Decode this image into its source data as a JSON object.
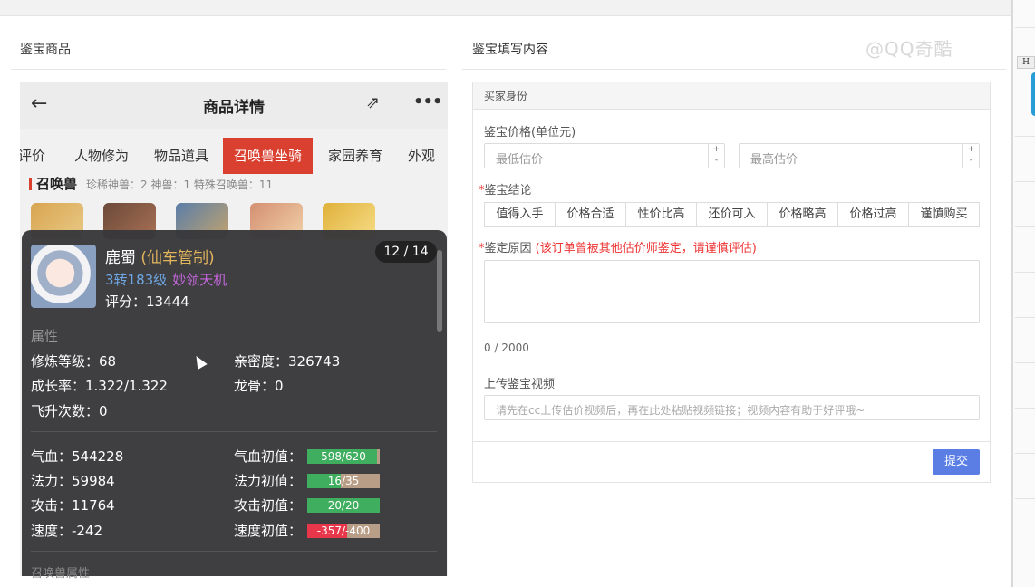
{
  "left_title": "鉴宝商品",
  "right_title": "鉴宝填写内容",
  "watermark": "@QQ奇酷",
  "sheet_col": "H",
  "phone": {
    "title": "商品详情",
    "back_icon": "←",
    "share_icon": "⇗",
    "more_icon": "•••",
    "tabs": [
      "评价",
      "人物修为",
      "物品道具",
      "召唤兽坐骑",
      "家园养育",
      "外观"
    ],
    "pet_label": "召唤兽",
    "pet_summary": "珍稀神兽：2   神兽：1   特殊召唤兽：11"
  },
  "card": {
    "name": "鹿蜀",
    "sub": "(仙车管制)",
    "counter": "12 / 14",
    "level": "3转183级",
    "magic": "妙领天机",
    "score": "评分：13444",
    "section": "属性",
    "stats_left": [
      "修炼等级：68",
      "成长率：1.322/1.322",
      "飞升次数：0"
    ],
    "stats_right": [
      "亲密度：326743",
      "龙骨：0"
    ],
    "attrs_left": [
      "气血：544228",
      "法力：59984",
      "攻击：11764",
      "速度：-242"
    ],
    "attrs_right": [
      "气血初值：",
      "法力初值：",
      "攻击初值：",
      "速度初值："
    ],
    "bars": [
      {
        "text": "598/620",
        "fraction": 0.96,
        "color": "#3fae5f"
      },
      {
        "text": "16/35",
        "fraction": 0.46,
        "color": "#3fae5f"
      },
      {
        "text": "20/20",
        "fraction": 1.0,
        "color": "#3fae5f"
      },
      {
        "text": "-357/-400",
        "fraction": 0.55,
        "color": "#e8364a"
      }
    ],
    "bottom": "召唤兽属性"
  },
  "form": {
    "section_head": "买家身份",
    "price_label": "鉴宝价格(单位元)",
    "min_placeholder": "最低估价",
    "max_placeholder": "最高估价",
    "conclusion_label": "鉴宝结论",
    "options": [
      "值得入手",
      "价格合适",
      "性价比高",
      "还价可入",
      "价格略高",
      "价格过高",
      "谨慎购买"
    ],
    "reason_label": "鉴定原因",
    "reason_warning": "(该订单曾被其他估价师鉴定，请谨慎评估)",
    "count": "0 / 2000",
    "video_label": "上传鉴宝视频",
    "video_placeholder": "请先在cc上传估价视频后，再在此处粘贴视频链接；视频内容有助于好评哦~",
    "submit": "提交"
  }
}
